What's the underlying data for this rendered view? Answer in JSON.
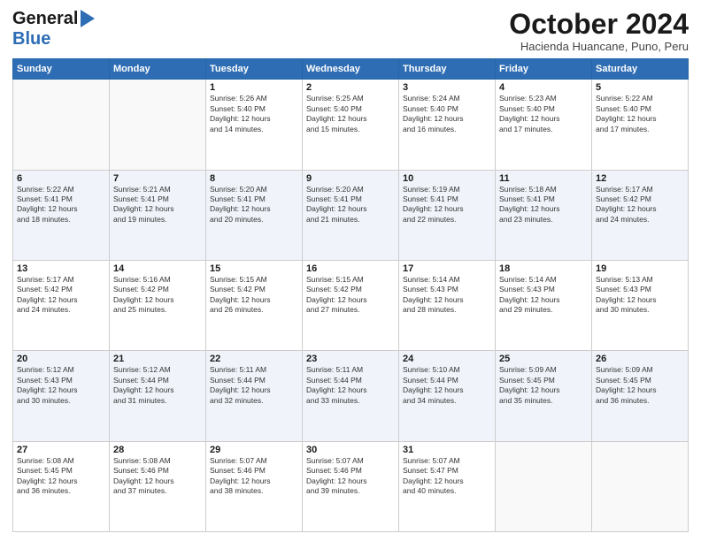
{
  "header": {
    "logo_line1": "General",
    "logo_line2": "Blue",
    "month": "October 2024",
    "location": "Hacienda Huancane, Puno, Peru"
  },
  "days_of_week": [
    "Sunday",
    "Monday",
    "Tuesday",
    "Wednesday",
    "Thursday",
    "Friday",
    "Saturday"
  ],
  "weeks": [
    [
      {
        "day": "",
        "info": ""
      },
      {
        "day": "",
        "info": ""
      },
      {
        "day": "1",
        "info": "Sunrise: 5:26 AM\nSunset: 5:40 PM\nDaylight: 12 hours\nand 14 minutes."
      },
      {
        "day": "2",
        "info": "Sunrise: 5:25 AM\nSunset: 5:40 PM\nDaylight: 12 hours\nand 15 minutes."
      },
      {
        "day": "3",
        "info": "Sunrise: 5:24 AM\nSunset: 5:40 PM\nDaylight: 12 hours\nand 16 minutes."
      },
      {
        "day": "4",
        "info": "Sunrise: 5:23 AM\nSunset: 5:40 PM\nDaylight: 12 hours\nand 17 minutes."
      },
      {
        "day": "5",
        "info": "Sunrise: 5:22 AM\nSunset: 5:40 PM\nDaylight: 12 hours\nand 17 minutes."
      }
    ],
    [
      {
        "day": "6",
        "info": "Sunrise: 5:22 AM\nSunset: 5:41 PM\nDaylight: 12 hours\nand 18 minutes."
      },
      {
        "day": "7",
        "info": "Sunrise: 5:21 AM\nSunset: 5:41 PM\nDaylight: 12 hours\nand 19 minutes."
      },
      {
        "day": "8",
        "info": "Sunrise: 5:20 AM\nSunset: 5:41 PM\nDaylight: 12 hours\nand 20 minutes."
      },
      {
        "day": "9",
        "info": "Sunrise: 5:20 AM\nSunset: 5:41 PM\nDaylight: 12 hours\nand 21 minutes."
      },
      {
        "day": "10",
        "info": "Sunrise: 5:19 AM\nSunset: 5:41 PM\nDaylight: 12 hours\nand 22 minutes."
      },
      {
        "day": "11",
        "info": "Sunrise: 5:18 AM\nSunset: 5:41 PM\nDaylight: 12 hours\nand 23 minutes."
      },
      {
        "day": "12",
        "info": "Sunrise: 5:17 AM\nSunset: 5:42 PM\nDaylight: 12 hours\nand 24 minutes."
      }
    ],
    [
      {
        "day": "13",
        "info": "Sunrise: 5:17 AM\nSunset: 5:42 PM\nDaylight: 12 hours\nand 24 minutes."
      },
      {
        "day": "14",
        "info": "Sunrise: 5:16 AM\nSunset: 5:42 PM\nDaylight: 12 hours\nand 25 minutes."
      },
      {
        "day": "15",
        "info": "Sunrise: 5:15 AM\nSunset: 5:42 PM\nDaylight: 12 hours\nand 26 minutes."
      },
      {
        "day": "16",
        "info": "Sunrise: 5:15 AM\nSunset: 5:42 PM\nDaylight: 12 hours\nand 27 minutes."
      },
      {
        "day": "17",
        "info": "Sunrise: 5:14 AM\nSunset: 5:43 PM\nDaylight: 12 hours\nand 28 minutes."
      },
      {
        "day": "18",
        "info": "Sunrise: 5:14 AM\nSunset: 5:43 PM\nDaylight: 12 hours\nand 29 minutes."
      },
      {
        "day": "19",
        "info": "Sunrise: 5:13 AM\nSunset: 5:43 PM\nDaylight: 12 hours\nand 30 minutes."
      }
    ],
    [
      {
        "day": "20",
        "info": "Sunrise: 5:12 AM\nSunset: 5:43 PM\nDaylight: 12 hours\nand 30 minutes."
      },
      {
        "day": "21",
        "info": "Sunrise: 5:12 AM\nSunset: 5:44 PM\nDaylight: 12 hours\nand 31 minutes."
      },
      {
        "day": "22",
        "info": "Sunrise: 5:11 AM\nSunset: 5:44 PM\nDaylight: 12 hours\nand 32 minutes."
      },
      {
        "day": "23",
        "info": "Sunrise: 5:11 AM\nSunset: 5:44 PM\nDaylight: 12 hours\nand 33 minutes."
      },
      {
        "day": "24",
        "info": "Sunrise: 5:10 AM\nSunset: 5:44 PM\nDaylight: 12 hours\nand 34 minutes."
      },
      {
        "day": "25",
        "info": "Sunrise: 5:09 AM\nSunset: 5:45 PM\nDaylight: 12 hours\nand 35 minutes."
      },
      {
        "day": "26",
        "info": "Sunrise: 5:09 AM\nSunset: 5:45 PM\nDaylight: 12 hours\nand 36 minutes."
      }
    ],
    [
      {
        "day": "27",
        "info": "Sunrise: 5:08 AM\nSunset: 5:45 PM\nDaylight: 12 hours\nand 36 minutes."
      },
      {
        "day": "28",
        "info": "Sunrise: 5:08 AM\nSunset: 5:46 PM\nDaylight: 12 hours\nand 37 minutes."
      },
      {
        "day": "29",
        "info": "Sunrise: 5:07 AM\nSunset: 5:46 PM\nDaylight: 12 hours\nand 38 minutes."
      },
      {
        "day": "30",
        "info": "Sunrise: 5:07 AM\nSunset: 5:46 PM\nDaylight: 12 hours\nand 39 minutes."
      },
      {
        "day": "31",
        "info": "Sunrise: 5:07 AM\nSunset: 5:47 PM\nDaylight: 12 hours\nand 40 minutes."
      },
      {
        "day": "",
        "info": ""
      },
      {
        "day": "",
        "info": ""
      }
    ]
  ]
}
